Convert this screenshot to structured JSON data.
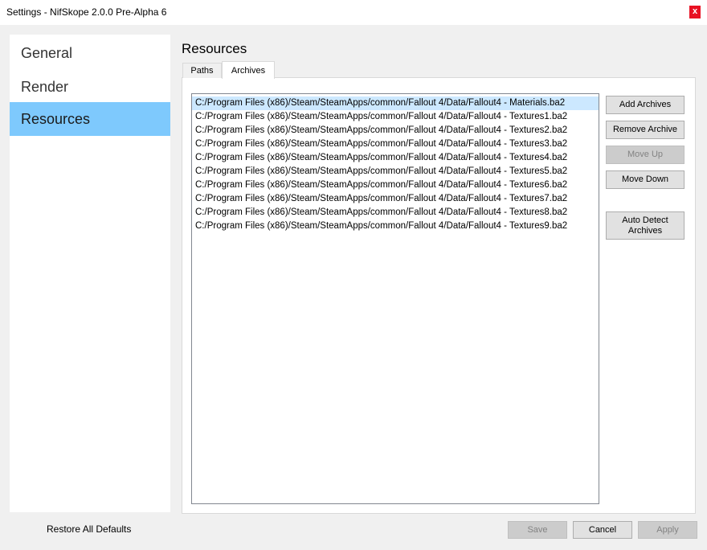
{
  "window": {
    "title": "Settings - NifSkope 2.0.0 Pre-Alpha 6",
    "close_glyph": "x"
  },
  "sidebar": {
    "items": [
      {
        "label": "General"
      },
      {
        "label": "Render"
      },
      {
        "label": "Resources"
      }
    ],
    "active_index": 2,
    "restore_label": "Restore All Defaults"
  },
  "main": {
    "title": "Resources",
    "tabs": [
      {
        "label": "Paths"
      },
      {
        "label": "Archives"
      }
    ],
    "active_tab": "Archives",
    "archives": [
      "C:/Program Files (x86)/Steam/SteamApps/common/Fallout 4/Data/Fallout4 - Materials.ba2",
      "C:/Program Files (x86)/Steam/SteamApps/common/Fallout 4/Data/Fallout4 - Textures1.ba2",
      "C:/Program Files (x86)/Steam/SteamApps/common/Fallout 4/Data/Fallout4 - Textures2.ba2",
      "C:/Program Files (x86)/Steam/SteamApps/common/Fallout 4/Data/Fallout4 - Textures3.ba2",
      "C:/Program Files (x86)/Steam/SteamApps/common/Fallout 4/Data/Fallout4 - Textures4.ba2",
      "C:/Program Files (x86)/Steam/SteamApps/common/Fallout 4/Data/Fallout4 - Textures5.ba2",
      "C:/Program Files (x86)/Steam/SteamApps/common/Fallout 4/Data/Fallout4 - Textures6.ba2",
      "C:/Program Files (x86)/Steam/SteamApps/common/Fallout 4/Data/Fallout4 - Textures7.ba2",
      "C:/Program Files (x86)/Steam/SteamApps/common/Fallout 4/Data/Fallout4 - Textures8.ba2",
      "C:/Program Files (x86)/Steam/SteamApps/common/Fallout 4/Data/Fallout4 - Textures9.ba2"
    ],
    "selected_index": 0,
    "buttons": {
      "add": "Add Archives",
      "remove": "Remove Archive",
      "move_up": "Move Up",
      "move_down": "Move Down",
      "auto_detect_line1": "Auto Detect",
      "auto_detect_line2": "Archives"
    }
  },
  "footer": {
    "save": "Save",
    "cancel": "Cancel",
    "apply": "Apply"
  },
  "colors": {
    "selection": "#7ec9fd",
    "list_selection": "#cce8ff",
    "close_red": "#e81123"
  }
}
